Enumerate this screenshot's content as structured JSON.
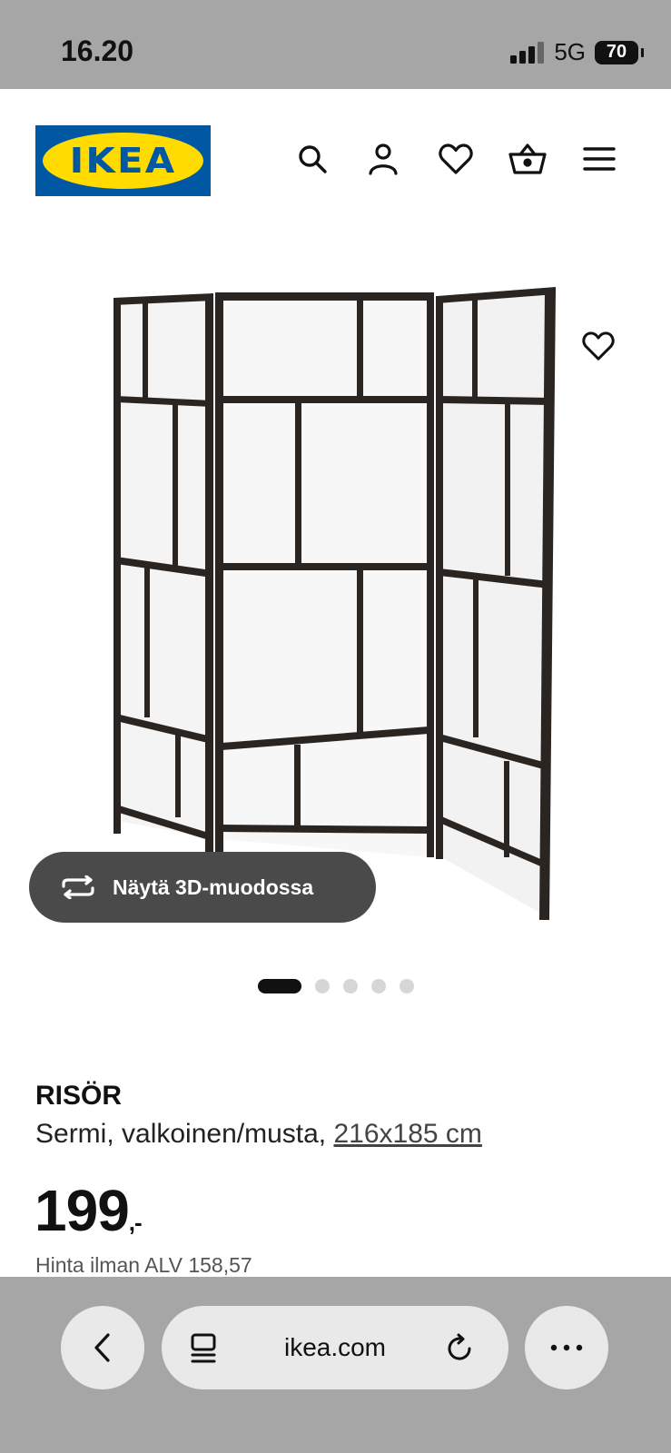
{
  "status_bar": {
    "time": "16.20",
    "network": "5G",
    "battery": "70"
  },
  "header": {
    "logo_text": "IKEA",
    "icons": [
      "search-icon",
      "account-icon",
      "favourites-icon",
      "cart-icon",
      "menu-icon"
    ]
  },
  "gallery": {
    "view_3d_label": "Näytä 3D-muodossa",
    "image_count": 5,
    "active_index": 0
  },
  "product": {
    "name": "RISÖR",
    "description": "Sermi, valkoinen/musta,",
    "size": "216x185 cm",
    "price": "199",
    "price_suffix": ",-",
    "vat_text": "Hinta ilman ALV 158,57"
  },
  "browser": {
    "url": "ikea.com"
  },
  "colors": {
    "ikea_blue": "#0058a3",
    "ikea_yellow": "#ffdb00",
    "frame": "#2b2522"
  }
}
